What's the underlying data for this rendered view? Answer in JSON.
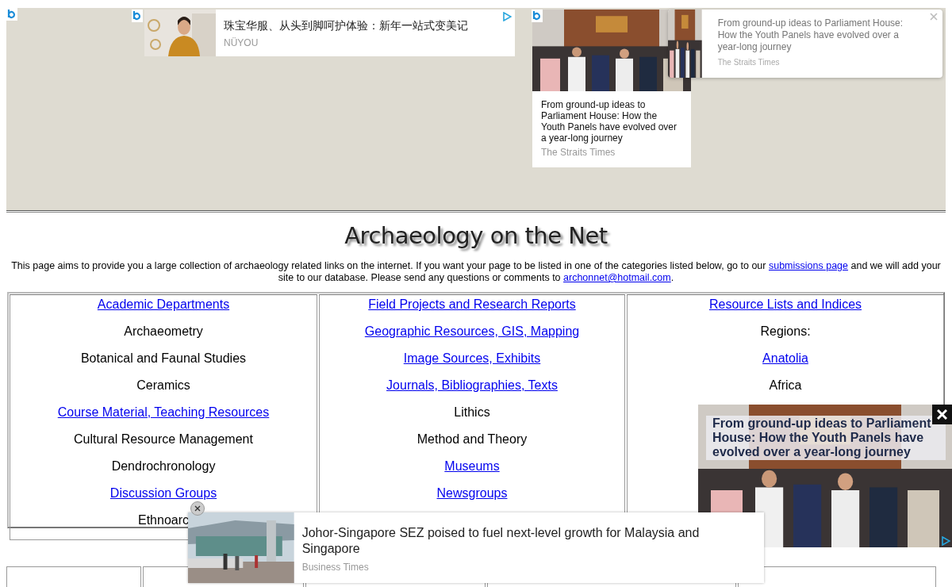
{
  "top_ads": [
    {
      "kind": "inline",
      "headline": "珠宝华服、从头到脚呵护体验：新年一站式变美记",
      "source": "NÜYOU"
    },
    {
      "kind": "card",
      "headline": "From ground-up ideas to Parliament House: How the Youth Panels have evolved over a year-long journey",
      "source": "The Straits Times"
    },
    {
      "kind": "banner",
      "headline": "From ground-up ideas to Parliament House: How the Youth Panels have evolved over a year-long journey",
      "source": "The Straits Times"
    }
  ],
  "title": "Archaeology on the Net",
  "intro": [
    {
      "kind": "text",
      "text": "This page aims to provide you a large collection of archaeology related links on the internet. If you want your page to be listed in one of the categories listed below, go to our "
    },
    {
      "kind": "link",
      "text": "submissions page"
    },
    {
      "kind": "text",
      "text": " and we will add your site to our database. Please send any questions or comments to "
    },
    {
      "kind": "link",
      "text": "archonnet@hotmail.com"
    },
    {
      "kind": "text",
      "text": "."
    }
  ],
  "categories": [
    {
      "items": [
        {
          "label": "Academic Departments",
          "link": true
        },
        {
          "label": "Archaeometry",
          "link": false
        },
        {
          "label": "Botanical and Faunal Studies",
          "link": false
        },
        {
          "label": "Ceramics",
          "link": false
        },
        {
          "label": "Course Material, Teaching Resources",
          "link": true
        },
        {
          "label": "Cultural Resource Management",
          "link": false
        },
        {
          "label": "Dendrochronology",
          "link": false
        },
        {
          "label": "Discussion Groups",
          "link": true
        },
        {
          "label": "Ethnoarc",
          "link": false
        }
      ]
    },
    {
      "items": [
        {
          "label": "Field Projects and Research Reports",
          "link": true
        },
        {
          "label": "Geographic Resources, GIS, Mapping",
          "link": true
        },
        {
          "label": "Image Sources, Exhibits",
          "link": true
        },
        {
          "label": "Journals, Bibliographies, Texts",
          "link": true
        },
        {
          "label": "Lithics",
          "link": false
        },
        {
          "label": "Method and Theory",
          "link": false
        },
        {
          "label": "Museums",
          "link": true
        },
        {
          "label": "Newsgroups",
          "link": true
        }
      ]
    },
    {
      "items": [
        {
          "label": "Resource Lists and Indices",
          "link": true
        },
        {
          "label": "Regions:",
          "link": false
        },
        {
          "label": "Anatolia",
          "link": true
        },
        {
          "label": "Africa",
          "link": false
        }
      ]
    }
  ],
  "video_ad": {
    "headline": "From ground-up ideas to Parliament House: How the Youth Panels have evolved over a year-long journey"
  },
  "bottom_ad": {
    "headline": "Johor-Singapore SEZ poised to fuel next-level growth for Malaysia and Singapore",
    "source": "Business Times"
  }
}
